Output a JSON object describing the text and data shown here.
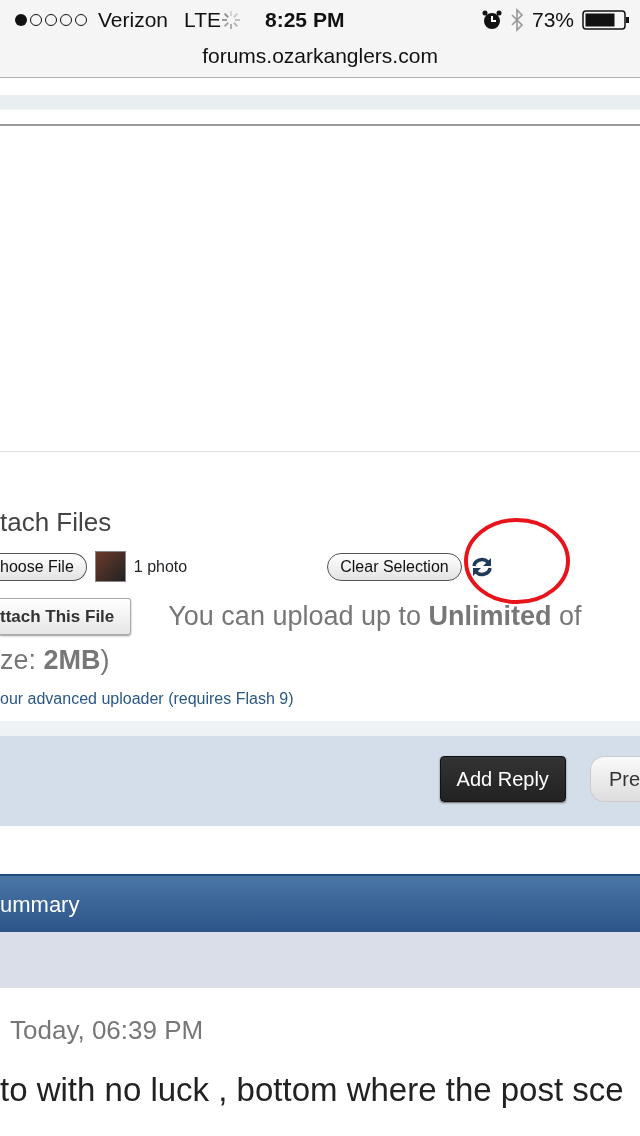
{
  "status_bar": {
    "carrier": "Verizon",
    "network": "LTE",
    "time": "8:25 PM",
    "battery": "73%"
  },
  "address_bar": {
    "url": "forums.ozarkanglers.com"
  },
  "attach": {
    "title": "tach Files",
    "choose_button": "hoose File",
    "file_label": "1 photo",
    "clear_button": "Clear Selection",
    "attach_button": "ttach This File",
    "info_line": "You can upload up to **Unlimited** of",
    "info_line_2": "ze: **2MB**)",
    "uploader_link": "our advanced uploader (requires Flash 9)"
  },
  "reply_bar": {
    "buttons": [
      {
        "label": "Add Reply",
        "kind": "primary"
      },
      {
        "label": "Pre",
        "kind": "secondary"
      }
    ]
  },
  "summary": {
    "title": "ummary",
    "date": "Today, 06:39 PM",
    "text": "to with no luck , bottom where the post sce"
  }
}
